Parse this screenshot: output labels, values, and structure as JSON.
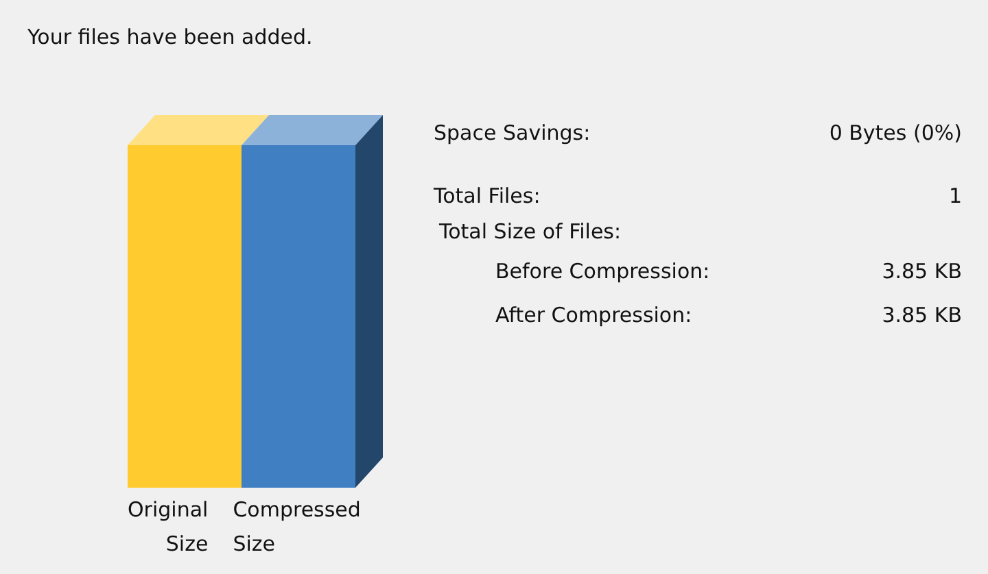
{
  "message": "Your files have been added.",
  "bars": [
    {
      "label": "Original Size",
      "color": "#ffcb2f"
    },
    {
      "label": "Compressed Size",
      "color": "#3f7fc2"
    }
  ],
  "stats": [
    {
      "label": "Space Savings:",
      "value": "0 Bytes (0%)"
    },
    {
      "label": "Total Files:",
      "value": "1"
    },
    {
      "label": "Total Size of Files:",
      "children": [
        {
          "label": "Before Compression:",
          "value": "3.85 KB"
        },
        {
          "label": "After Compression:",
          "value": "3.85 KB"
        }
      ]
    }
  ]
}
